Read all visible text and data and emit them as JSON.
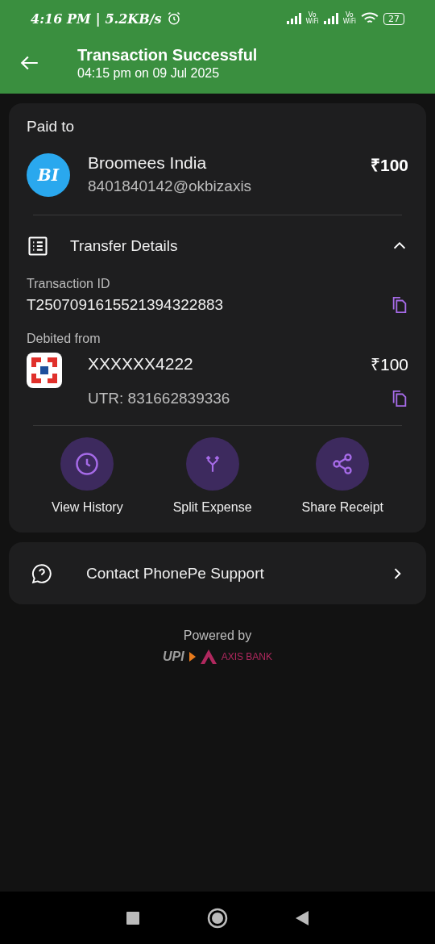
{
  "status_bar": {
    "time": "4:16 PM",
    "separator": "|",
    "speed": "5.2KB/s",
    "sim_labels": [
      "Vo\nWiFi",
      "Vo\nWiFi"
    ],
    "battery": "27"
  },
  "header": {
    "title": "Transaction Successful",
    "subtitle": "04:15 pm on 09 Jul 2025"
  },
  "paid_to": {
    "label": "Paid to",
    "initials": "BI",
    "name": "Broomees India",
    "upi_id": "8401840142@okbizaxis",
    "amount": "₹100"
  },
  "transfer_details": {
    "title": "Transfer Details",
    "expanded": true,
    "transaction_id_label": "Transaction ID",
    "transaction_id": "T2507091615521394322883",
    "debited_label": "Debited from",
    "account": "XXXXXX4222",
    "amount": "₹100",
    "utr": "UTR: 831662839336"
  },
  "actions": [
    {
      "kind": "history",
      "label": "View History"
    },
    {
      "kind": "split",
      "label": "Split Expense"
    },
    {
      "kind": "share",
      "label": "Share Receipt"
    }
  ],
  "support": {
    "label": "Contact PhonePe Support"
  },
  "footer": {
    "powered_by": "Powered by",
    "upi_logo": "UPI",
    "bank_logo": "AXIS BANK"
  }
}
